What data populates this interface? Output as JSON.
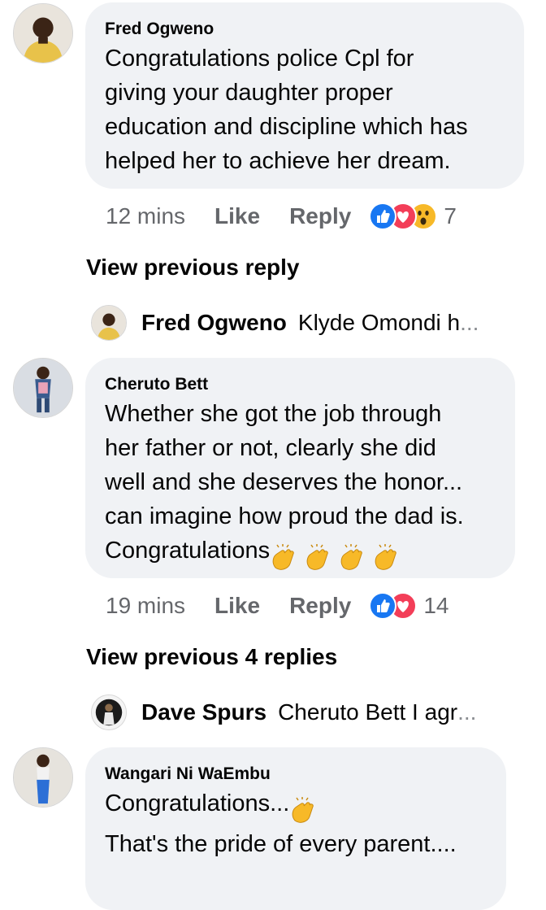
{
  "comments": [
    {
      "author": "Fred Ogweno",
      "lines": [
        "Congratulations police Cpl for",
        "giving your daughter proper",
        "education and discipline which has",
        "helped her to achieve her dream."
      ],
      "time": "12 mins",
      "like_label": "Like",
      "reply_label": "Reply",
      "reaction_icons": [
        "like-icon",
        "love-icon",
        "wow-icon"
      ],
      "reaction_count": "7",
      "view_previous": "View previous reply",
      "reply_preview": {
        "name": "Fred Ogweno",
        "text": "Klyde Omondi h",
        "ellipsis": "..."
      }
    },
    {
      "author": "Cheruto Bett",
      "lines": [
        "Whether she got the job through",
        "her father or not, clearly she did",
        "well and she deserves the honor...",
        "can imagine how proud the dad is.",
        "Congratulations"
      ],
      "line_emojis": [
        "clapping-hands-icon",
        "clapping-hands-icon",
        "clapping-hands-icon",
        "clapping-hands-icon"
      ],
      "time": "19 mins",
      "like_label": "Like",
      "reply_label": "Reply",
      "reaction_icons": [
        "like-icon",
        "love-icon"
      ],
      "reaction_count": "14",
      "view_previous": "View previous 4 replies",
      "reply_preview": {
        "name": "Dave Spurs",
        "text": "Cheruto Bett I agr",
        "ellipsis": "..."
      }
    },
    {
      "author": "Wangari Ni WaEmbu",
      "lines": [
        "Congratulations...",
        "That's the pride of every parent...."
      ],
      "line_emojis": [
        "clapping-hands-icon"
      ]
    }
  ],
  "colors": {
    "bubble_bg": "#f0f2f5",
    "meta_gray": "#65676b",
    "like_blue": "#1877f2",
    "love_red": "#f33e58",
    "wow_yellow": "#f7b928"
  }
}
